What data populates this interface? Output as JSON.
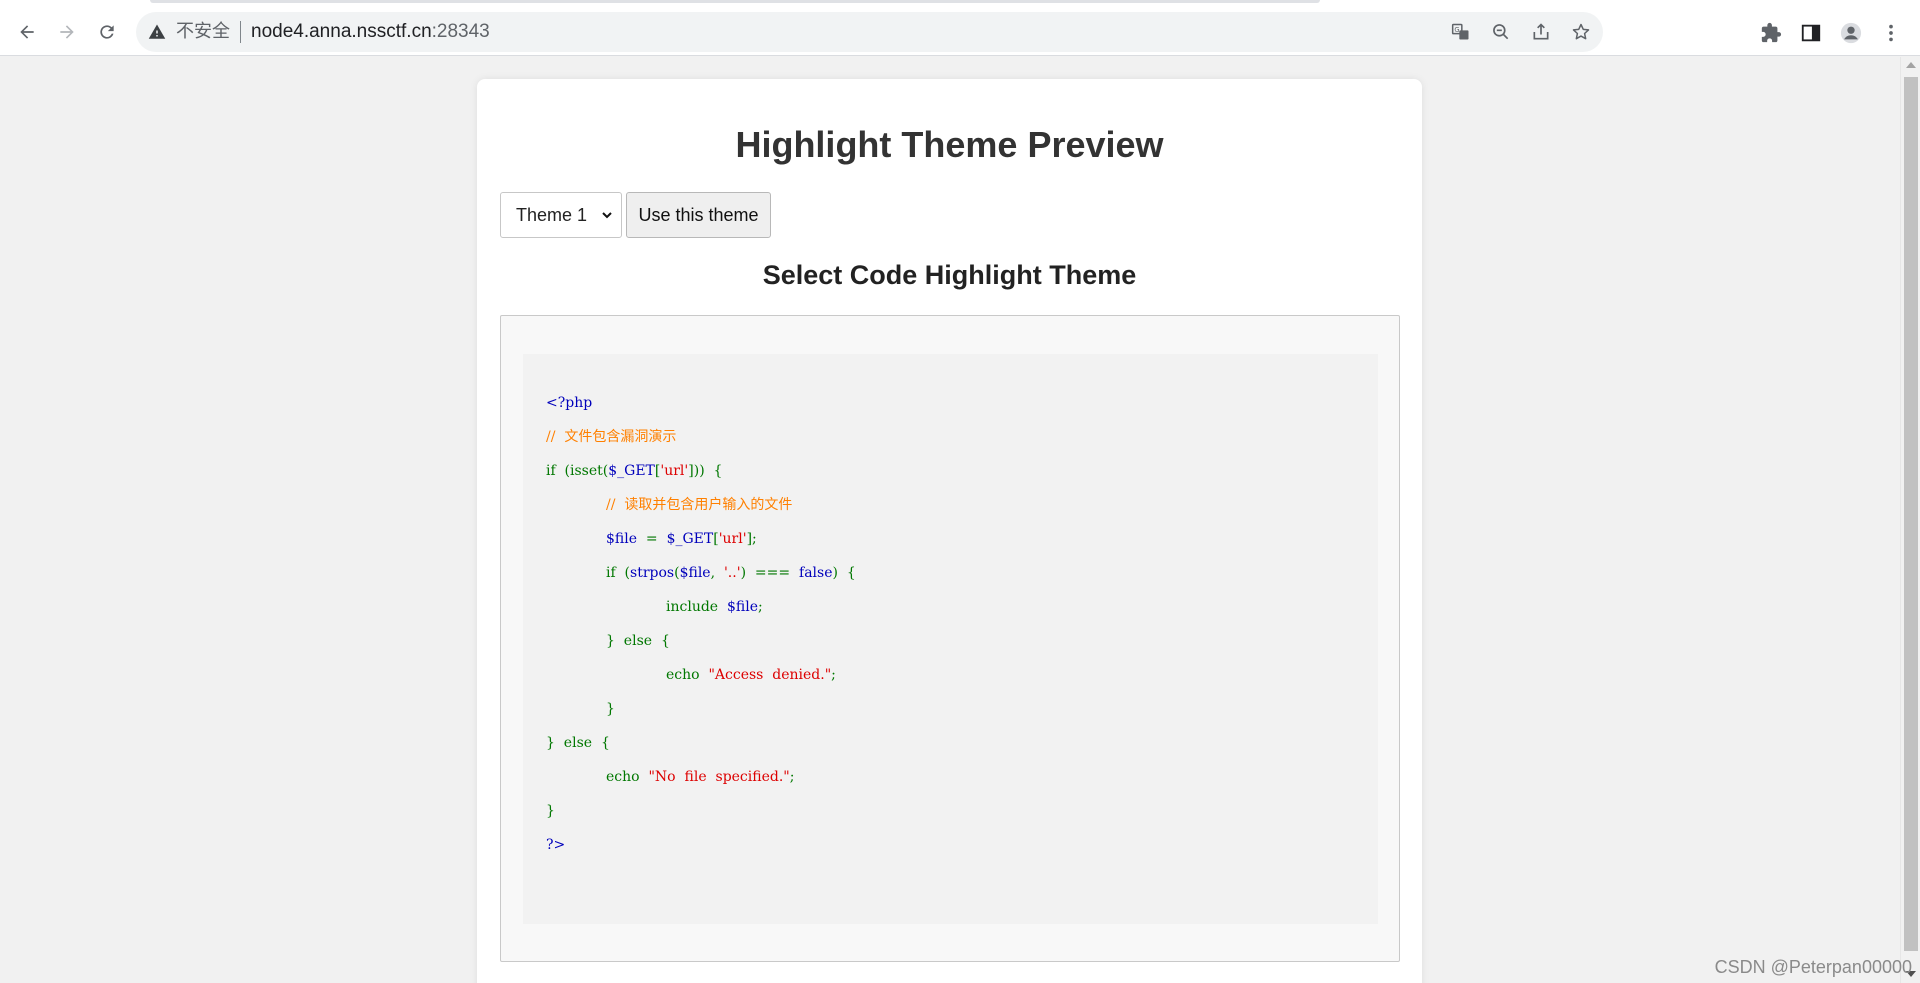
{
  "browser": {
    "security_label": "不安全",
    "url_host": "node4.anna.nssctf.cn",
    "url_port": ":28343",
    "icons": [
      "back-icon",
      "forward-icon",
      "reload-icon",
      "warning-icon",
      "translate-icon",
      "zoom-out-icon",
      "share-icon",
      "star-icon",
      "extensions-icon",
      "side-panel-icon",
      "profile-icon",
      "menu-icon"
    ]
  },
  "page": {
    "title": "Highlight Theme Preview",
    "theme_select": {
      "selected": "Theme 1"
    },
    "use_button_label": "Use this theme",
    "subtitle": "Select Code Highlight Theme"
  },
  "code": {
    "colors": {
      "delim": "#0000BB",
      "comment": "#FF8000",
      "keyword": "#007700",
      "default": "#0000BB",
      "string": "#DD0000"
    },
    "lines": [
      {
        "indent": 0,
        "tokens": [
          {
            "t": "<?php",
            "c": "delim"
          }
        ]
      },
      {
        "indent": 0,
        "tokens": [
          {
            "t": "//  文件包含漏洞演示",
            "c": "comment"
          }
        ]
      },
      {
        "indent": 0,
        "tokens": [
          {
            "t": "if  (isset(",
            "c": "keyword"
          },
          {
            "t": "$_GET",
            "c": "default"
          },
          {
            "t": "[",
            "c": "keyword"
          },
          {
            "t": "'url'",
            "c": "string"
          },
          {
            "t": "]))  {",
            "c": "keyword"
          }
        ]
      },
      {
        "indent": 1,
        "tokens": [
          {
            "t": "//  读取并包含用户输入的文件",
            "c": "comment"
          }
        ]
      },
      {
        "indent": 1,
        "tokens": [
          {
            "t": "$file  ",
            "c": "default"
          },
          {
            "t": "=  ",
            "c": "keyword"
          },
          {
            "t": "$_GET",
            "c": "default"
          },
          {
            "t": "[",
            "c": "keyword"
          },
          {
            "t": "'url'",
            "c": "string"
          },
          {
            "t": "];",
            "c": "keyword"
          }
        ]
      },
      {
        "indent": 1,
        "tokens": [
          {
            "t": "if  (",
            "c": "keyword"
          },
          {
            "t": "strpos",
            "c": "default"
          },
          {
            "t": "(",
            "c": "keyword"
          },
          {
            "t": "$file",
            "c": "default"
          },
          {
            "t": ",  ",
            "c": "keyword"
          },
          {
            "t": "'..'",
            "c": "string"
          },
          {
            "t": ")  ===  ",
            "c": "keyword"
          },
          {
            "t": "false",
            "c": "default"
          },
          {
            "t": ")  {",
            "c": "keyword"
          }
        ]
      },
      {
        "indent": 2,
        "tokens": [
          {
            "t": "include  ",
            "c": "keyword"
          },
          {
            "t": "$file",
            "c": "default"
          },
          {
            "t": ";",
            "c": "keyword"
          }
        ]
      },
      {
        "indent": 1,
        "tokens": [
          {
            "t": "}  else  {",
            "c": "keyword"
          }
        ]
      },
      {
        "indent": 2,
        "tokens": [
          {
            "t": "echo  ",
            "c": "keyword"
          },
          {
            "t": "\"Access  denied.\"",
            "c": "string"
          },
          {
            "t": ";",
            "c": "keyword"
          }
        ]
      },
      {
        "indent": 1,
        "tokens": [
          {
            "t": "}",
            "c": "keyword"
          }
        ]
      },
      {
        "indent": 0,
        "tokens": [
          {
            "t": "}  else  {",
            "c": "keyword"
          }
        ]
      },
      {
        "indent": 1,
        "tokens": [
          {
            "t": "echo  ",
            "c": "keyword"
          },
          {
            "t": "\"No  file  specified.\"",
            "c": "string"
          },
          {
            "t": ";",
            "c": "keyword"
          }
        ]
      },
      {
        "indent": 0,
        "tokens": [
          {
            "t": "}",
            "c": "keyword"
          }
        ]
      },
      {
        "indent": 0,
        "tokens": [
          {
            "t": "?>",
            "c": "delim"
          }
        ]
      }
    ]
  },
  "watermark": "CSDN @Peterpan00000"
}
